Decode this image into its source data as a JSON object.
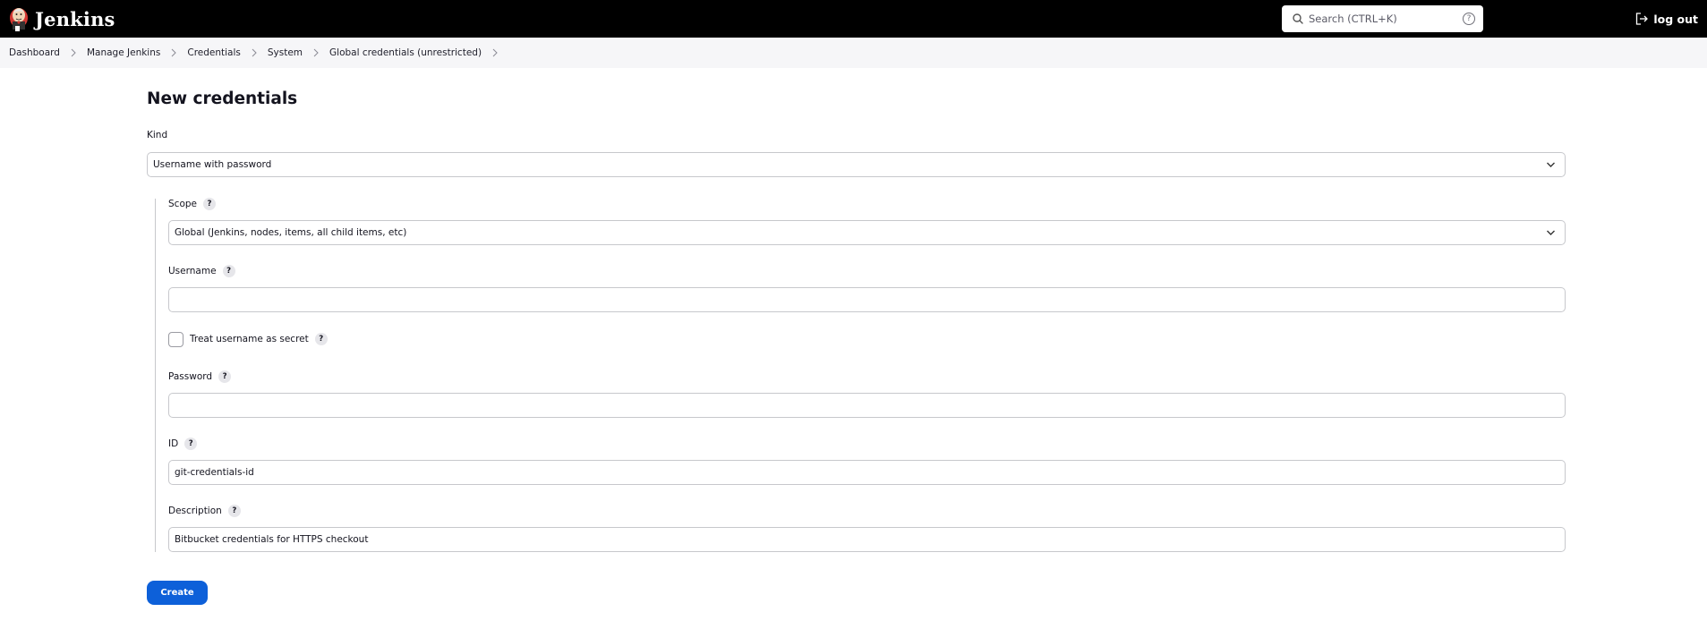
{
  "header": {
    "app_name": "Jenkins",
    "logo_icon": "jenkins-butler-logo",
    "search": {
      "placeholder": "Search (CTRL+K)",
      "value": "",
      "icon": "search-icon",
      "help_icon": "question-circle-icon"
    },
    "logout": {
      "label": "log out",
      "icon": "logout-icon"
    }
  },
  "breadcrumb": {
    "items": [
      {
        "label": "Dashboard"
      },
      {
        "label": "Manage Jenkins"
      },
      {
        "label": "Credentials"
      },
      {
        "label": "System"
      },
      {
        "label": "Global credentials (unrestricted)"
      }
    ],
    "separator_icon": "chevron-right-icon"
  },
  "main": {
    "title": "New credentials",
    "kind": {
      "label": "Kind",
      "selected": "Username with password"
    },
    "fields": {
      "scope": {
        "label": "Scope",
        "help": "?",
        "selected": "Global (Jenkins, nodes, items, all child items, etc)"
      },
      "username": {
        "label": "Username",
        "help": "?",
        "value": ""
      },
      "treat_secret": {
        "label": "Treat username as secret",
        "help": "?",
        "checked": false
      },
      "password": {
        "label": "Password",
        "help": "?",
        "value": ""
      },
      "id": {
        "label": "ID",
        "help": "?",
        "value": "git-credentials-id"
      },
      "description": {
        "label": "Description",
        "help": "?",
        "value": "Bitbucket credentials for HTTPS checkout"
      }
    },
    "create_button": "Create"
  },
  "colors": {
    "header_bg": "#000000",
    "breadcrumb_bg": "#f6f6f8",
    "primary_button": "#0d60d9",
    "input_border": "#c7c8cc"
  }
}
